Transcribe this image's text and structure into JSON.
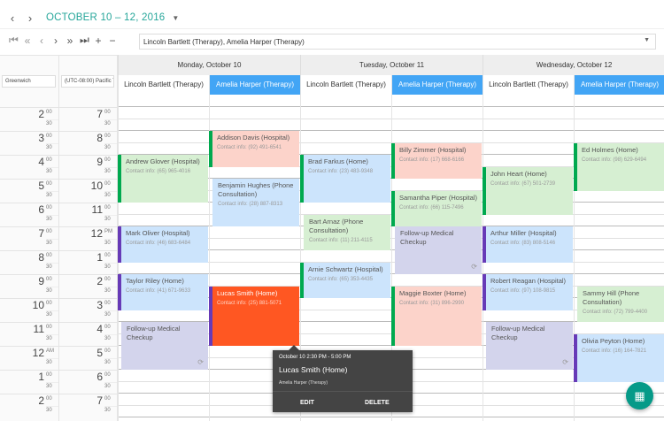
{
  "nav": {
    "prev_icon": "chevron-left-icon",
    "next_icon": "chevron-right-icon",
    "date_range": "OCTOBER 10 – 12, 2016",
    "dropdown_icon": "caret-down-icon"
  },
  "toolbar": {
    "icons": [
      "first-icon",
      "fast-back-icon",
      "back-icon",
      "forward-icon",
      "fast-forward-icon",
      "last-icon",
      "zoom-in-icon",
      "zoom-out-icon"
    ],
    "glyphs": [
      "⏮",
      "«",
      "‹",
      "›",
      "»",
      "⏭",
      "+",
      "−"
    ]
  },
  "resource_selector": {
    "value": "Lincoln Bartlett (Therapy), Amelia Harper (Therapy)"
  },
  "timezones": [
    "Greenwich",
    "(UTC-08:00) Pacific T"
  ],
  "days": [
    "Monday, October 10",
    "Tuesday, October 11",
    "Wednesday, October 12"
  ],
  "resources": [
    "Lincoln Bartlett (Therapy)",
    "Amelia Harper (Therapy)"
  ],
  "time_left": [
    "2",
    "3",
    "4",
    "5",
    "6",
    "7",
    "8",
    "9",
    "10",
    "11",
    "12",
    "1",
    "2"
  ],
  "time_left_suffix": [
    "00",
    "00",
    "00",
    "00",
    "00",
    "00",
    "00",
    "00",
    "00",
    "00",
    "AM",
    "00",
    "00"
  ],
  "time_right": [
    "7",
    "8",
    "9",
    "10",
    "11",
    "12",
    "1",
    "2",
    "3",
    "4",
    "5",
    "6",
    "7"
  ],
  "time_right_suffix": [
    "00",
    "00",
    "00",
    "00",
    "00",
    "PM",
    "00",
    "00",
    "00",
    "00",
    "00",
    "00",
    "00"
  ],
  "half": "30",
  "colors": {
    "green": "#d6efd2",
    "blue": "#cce4fc",
    "pink": "#fcd3ca",
    "lavender": "#d3d4ec",
    "selected": "#ff5722",
    "bar_green": "#00a94f",
    "bar_purple": "#673ab7",
    "header_selected": "#42a5f5",
    "accent": "#26a69a"
  },
  "appointments": [
    {
      "name": "Andrew Glover (Hospital)",
      "contact": "Contact info: (65) 965-4016",
      "color": "g",
      "bar": "#00a94f"
    },
    {
      "name": "Mark Oliver (Hospital)",
      "contact": "Contact info: (46) 683-6484",
      "color": "b",
      "bar": "#673ab7"
    },
    {
      "name": "Taylor Riley (Home)",
      "contact": "Contact info: (41) 671-9633",
      "color": "b",
      "bar": "#673ab7"
    },
    {
      "name": "Follow-up Medical Checkup",
      "contact": "",
      "color": "l",
      "bar": "",
      "recurring": true
    },
    {
      "name": "Addison Davis (Hospital)",
      "contact": "Contact info: (92) 491-6541",
      "color": "p",
      "bar": "#00a94f"
    },
    {
      "name": "Benjamin Hughes (Phone Consultation)",
      "contact": "Contact info: (28) 887-8313",
      "color": "b",
      "bar": ""
    },
    {
      "name": "Lucas Smith (Home)",
      "contact": "Contact info: (25) 881-5071",
      "color": "o",
      "bar": "#673ab7"
    },
    {
      "name": "Brad Farkus (Home)",
      "contact": "Contact info: (23) 483-9348",
      "color": "b",
      "bar": "#00a94f"
    },
    {
      "name": "Bart Arnaz (Phone Consultation)",
      "contact": "Contact info: (11) 211-4115",
      "color": "g",
      "bar": ""
    },
    {
      "name": "Arnie Schwartz (Hospital)",
      "contact": "Contact info: (65) 353-4435",
      "color": "b",
      "bar": "#00a94f"
    },
    {
      "name": "Billy Zimmer (Hospital)",
      "contact": "Contact info: (17) 668-6166",
      "color": "p",
      "bar": "#00a94f"
    },
    {
      "name": "Samantha Piper (Hospital)",
      "contact": "Contact info: (66) 115-7496",
      "color": "g",
      "bar": "#00a94f"
    },
    {
      "name": "Follow-up Medical Checkup",
      "contact": "",
      "color": "l",
      "bar": "",
      "recurring": true
    },
    {
      "name": "Maggie Boxter (Home)",
      "contact": "Contact info: (31) 896-2990",
      "color": "p",
      "bar": "#00a94f"
    },
    {
      "name": "John Heart (Home)",
      "contact": "Contact info: (67) 501-2739",
      "color": "g",
      "bar": "#00a94f"
    },
    {
      "name": "Arthur Miller (Hospital)",
      "contact": "Contact info: (83) 808-5146",
      "color": "b",
      "bar": "#673ab7"
    },
    {
      "name": "Robert Reagan (Hospital)",
      "contact": "Contact info: (97) 108-9815",
      "color": "b",
      "bar": "#673ab7"
    },
    {
      "name": "Follow-up Medical Checkup",
      "contact": "",
      "color": "l",
      "bar": "",
      "recurring": true
    },
    {
      "name": "Ed Holmes (Home)",
      "contact": "Contact info: (98) 629-6494",
      "color": "g",
      "bar": "#00a94f"
    },
    {
      "name": "Sammy Hill (Phone Consultation)",
      "contact": "Contact info: (72) 799-4400",
      "color": "g",
      "bar": ""
    },
    {
      "name": "Olivia Peyton (Home)",
      "contact": "Contact info: (16) 164-7821",
      "color": "b",
      "bar": "#673ab7"
    }
  ],
  "tooltip": {
    "time": "October 10 2:30 PM - 5:00 PM",
    "title": "Lucas Smith (Home)",
    "resource": "Amelia Harper (Therapy)",
    "edit": "EDIT",
    "delete": "DELETE"
  },
  "fab": {
    "icon": "calendar-edit-icon"
  }
}
